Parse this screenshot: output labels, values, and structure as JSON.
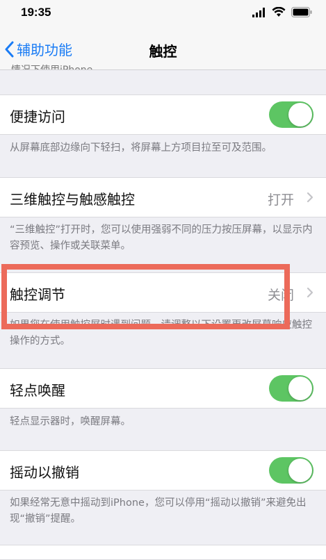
{
  "status_bar": {
    "time": "19:35"
  },
  "nav": {
    "back_label": "辅助功能",
    "title": "触控"
  },
  "cut_text": "情况下使用iPhone。",
  "rows": {
    "reachability": {
      "label": "便捷访问",
      "footer": "从屏幕底部边缘向下轻扫，将屏幕上方项目拉至可及范围。"
    },
    "touch3d": {
      "label": "三维触控与触感触控",
      "value": "打开",
      "footer": "“三维触控”打开时，您可以使用强弱不同的压力按压屏幕，以显示内容预览、操作或关联菜单。"
    },
    "touch_accommodations": {
      "label": "触控调节",
      "value": "关闭",
      "footer": "如果您在使用触控屏时遇到问题，请调整以下设置更改屏幕响应触控操作的方式。"
    },
    "tap_to_wake": {
      "label": "轻点唤醒",
      "footer": "轻点显示器时，唤醒屏幕。"
    },
    "shake_to_undo": {
      "label": "摇动以撤销",
      "footer": "如果经常无意中摇动到iPhone，您可以停用“摇动以撤销”来避免出现“撤销”提醒。"
    }
  },
  "colors": {
    "accent": "#1a7cf5",
    "toggle_on": "#5dc563",
    "highlight": "#ec6a5a"
  }
}
